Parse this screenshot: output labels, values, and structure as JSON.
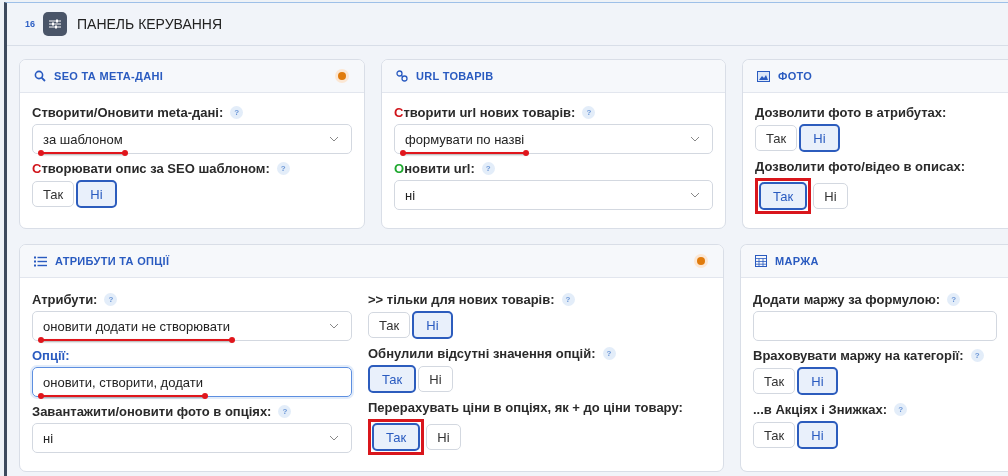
{
  "panel": {
    "number": "16",
    "title": "ПАНЕЛЬ КЕРУВАННЯ"
  },
  "rows": [
    [
      {
        "title": "SEO ТА МЕТА-ДАНІ",
        "color": "#e07b0c",
        "columns": [
          [
            {
              "kind": "select",
              "label": "Створити/Оновити meta-дані:",
              "help": "?",
              "value": "за шаблоном",
              "underlined": true
            },
            {
              "kind": "toggle",
              "label": "Створювати опис за SEO шаблоном:",
              "color": "#d0141a",
              "help": "?",
              "options": [
                {
                  "label": "Так",
                  "selected": false,
                  "highlighted": false
                },
                {
                  "label": "Ні",
                  "selected": true,
                  "highlighted": false
                }
              ]
            }
          ]
        ]
      },
      {
        "title": "URL ТОВАРІВ",
        "columns": [
          [
            {
              "kind": "select",
              "label": "Створити url нових товарів:",
              "color": "#d0141a",
              "help": "?",
              "value": "формувати по назві",
              "underlined": true
            },
            {
              "kind": "select",
              "label": "Оновити url:",
              "color": "#1ea82e",
              "help": "?",
              "value": "ні"
            }
          ]
        ]
      },
      {
        "title": "ФОТО",
        "columns": [
          [
            {
              "kind": "toggle",
              "label": "Дозволити фото в атрибутах:",
              "options": [
                {
                  "label": "Так",
                  "selected": false,
                  "highlighted": false
                },
                {
                  "label": "Ні",
                  "selected": true,
                  "highlighted": false
                }
              ]
            },
            {
              "kind": "toggle",
              "label": "Дозволити фото/відео в описах:",
              "options": [
                {
                  "label": "Так",
                  "selected": true,
                  "highlighted": true
                },
                {
                  "label": "Ні",
                  "selected": false,
                  "highlighted": false
                }
              ]
            }
          ]
        ]
      }
    ],
    [
      {
        "title": "АТРИБУТИ ТА ОПЦІЇ",
        "color": "#e07b0c",
        "columns": [
          [
            {
              "kind": "select",
              "label": "Атрибути:",
              "help": "?",
              "value": "оновити додати не створювати",
              "underlined": true
            },
            {
              "kind": "input",
              "label": "Опції:",
              "value": "оновити, створити, додати",
              "focused": true,
              "underlined": true
            },
            {
              "kind": "select",
              "label": "Завантажити/оновити фото в опціях:",
              "help": "?",
              "value": "ні"
            }
          ],
          [
            {
              "kind": "toggle",
              "label": ">> тільки для нових товарів:",
              "help": "?",
              "options": [
                {
                  "label": "Так",
                  "selected": false,
                  "highlighted": false
                },
                {
                  "label": "Ні",
                  "selected": true,
                  "highlighted": false
                }
              ]
            },
            {
              "kind": "toggle",
              "label": "Обнулили відсутні значення опцій:",
              "help": "?",
              "options": [
                {
                  "label": "Так",
                  "selected": true,
                  "highlighted": false
                },
                {
                  "label": "Ні",
                  "selected": false,
                  "highlighted": false
                }
              ]
            },
            {
              "kind": "toggle",
              "label": "Перерахувать ціни в опціях, як + до ціни товару:",
              "options": [
                {
                  "label": "Так",
                  "selected": true,
                  "highlighted": true
                },
                {
                  "label": "Ні",
                  "selected": false,
                  "highlighted": false
                }
              ]
            }
          ]
        ]
      },
      {
        "title": "МАРЖА",
        "columns": [
          [
            {
              "kind": "input",
              "label": "Додати маржу за формулою:",
              "help": "?",
              "focused": false
            },
            {
              "kind": "toggle",
              "label": "Враховувати маржу на категорії:",
              "help": "?",
              "options": [
                {
                  "label": "Так",
                  "selected": false,
                  "highlighted": false
                },
                {
                  "label": "Ні",
                  "selected": true,
                  "highlighted": false
                }
              ]
            },
            {
              "kind": "toggle",
              "label": "...в Акціях і Знижках:",
              "help": "?",
              "options": [
                {
                  "label": "Так",
                  "selected": false,
                  "highlighted": false
                },
                {
                  "label": "Ні",
                  "selected": true,
                  "highlighted": false
                }
              ]
            }
          ]
        ]
      }
    ]
  ]
}
